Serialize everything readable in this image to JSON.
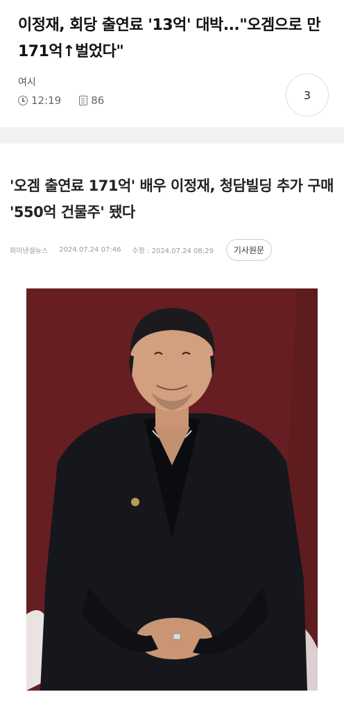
{
  "post": {
    "title": "이정재, 회당 출연료 '13억' 대박...\"오겜으로 만 171억↑벌었다\"",
    "author": "여시",
    "time": "12:19",
    "views": "86",
    "comment_count": "3"
  },
  "article": {
    "title": "'오겜 출연료 171억' 배우 이정재, 청담빌딩 추가 구매 '550억 건물주' 됐다",
    "source": "파이낸셜뉴스",
    "published": "2024.07.24 07:46",
    "modified": "수정 : 2024.07.24 08:29",
    "original_button": "기사원문"
  },
  "colors": {
    "backdrop": "#6e2226",
    "suit": "#15171c"
  }
}
